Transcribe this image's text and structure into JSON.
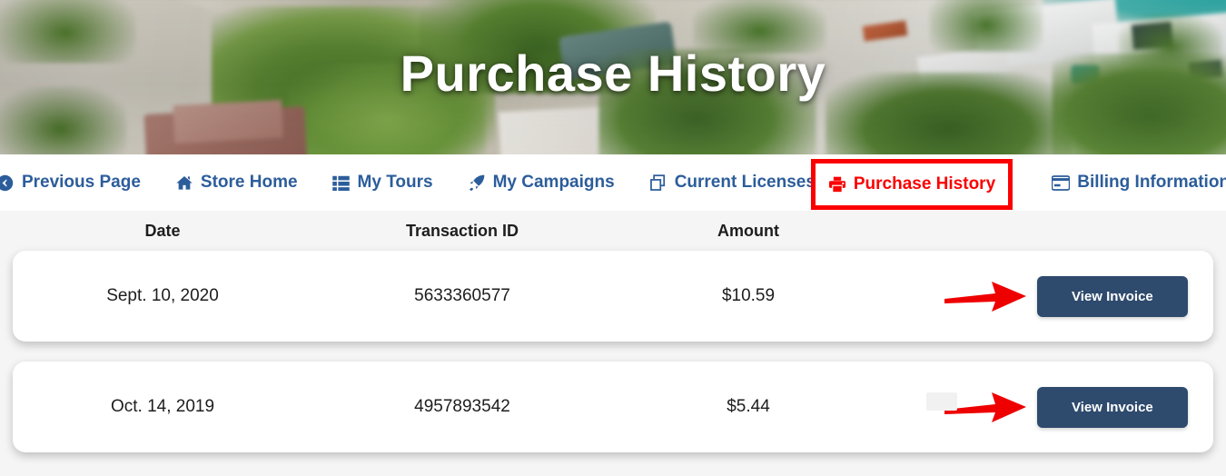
{
  "header": {
    "title": "Purchase History",
    "background_description": "aerial-resort-photo"
  },
  "nav": {
    "items": [
      {
        "label": "Previous Page",
        "icon": "arrow-circle-left-icon",
        "active": false
      },
      {
        "label": "Store Home",
        "icon": "home-icon",
        "active": false
      },
      {
        "label": "My Tours",
        "icon": "list-icon",
        "active": false
      },
      {
        "label": "My Campaigns",
        "icon": "rocket-icon",
        "active": false
      },
      {
        "label": "Current Licenses",
        "icon": "copy-icon",
        "active": false
      },
      {
        "label": "Purchase History",
        "icon": "print-icon",
        "active": true
      },
      {
        "label": "Billing Information",
        "icon": "credit-card-icon",
        "active": false
      }
    ],
    "link_color": "#2c5d9b",
    "active_color": "#fb0000",
    "highlight_color": "#fb0000"
  },
  "table": {
    "columns": [
      "Date",
      "Transaction ID",
      "Amount"
    ],
    "rows": [
      {
        "date": "Sept. 10, 2020",
        "transaction_id": "5633360577",
        "amount": "$10.59",
        "action_label": "View Invoice"
      },
      {
        "date": "Oct. 14, 2019",
        "transaction_id": "4957893542",
        "amount": "$5.44",
        "action_label": "View Invoice"
      }
    ],
    "button_color": "#2e4a6d",
    "arrow_color": "#ee0000"
  }
}
